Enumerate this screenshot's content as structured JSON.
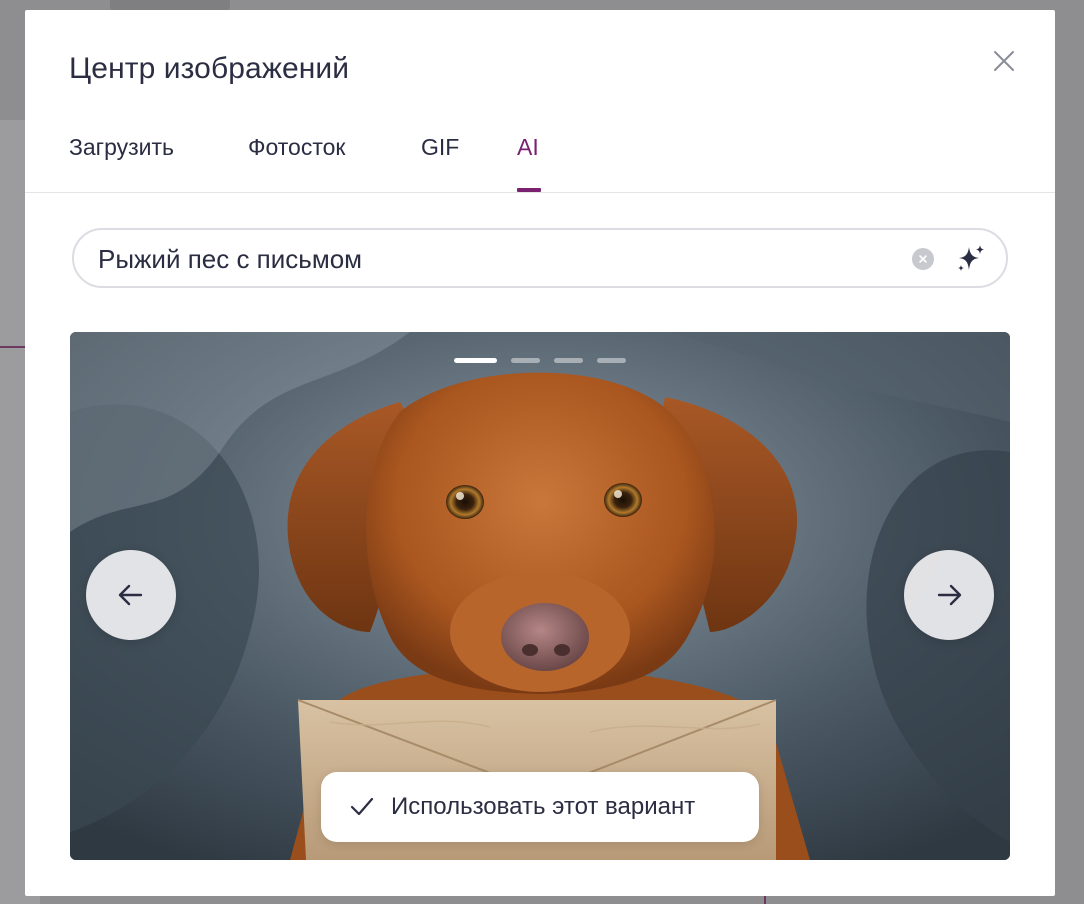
{
  "modal": {
    "title": "Центр изображений",
    "close_icon": "close-icon"
  },
  "tabs": [
    {
      "label": "Загрузить",
      "active": false
    },
    {
      "label": "Фотосток",
      "active": false
    },
    {
      "label": "GIF",
      "active": false
    },
    {
      "label": "AI",
      "active": true
    }
  ],
  "search": {
    "value": "Рыжий пес с письмом",
    "clear_icon": "clear-icon",
    "generate_icon": "sparkles-icon"
  },
  "carousel": {
    "slide_count": 4,
    "active_slide": 1,
    "prev_icon": "arrow-left-icon",
    "next_icon": "arrow-right-icon",
    "use_label": "Использовать этот вариант",
    "use_icon": "checkmark-icon"
  },
  "colors": {
    "accent": "#7a2270",
    "text": "#2b2d42",
    "backdrop": "#8e8e90"
  }
}
